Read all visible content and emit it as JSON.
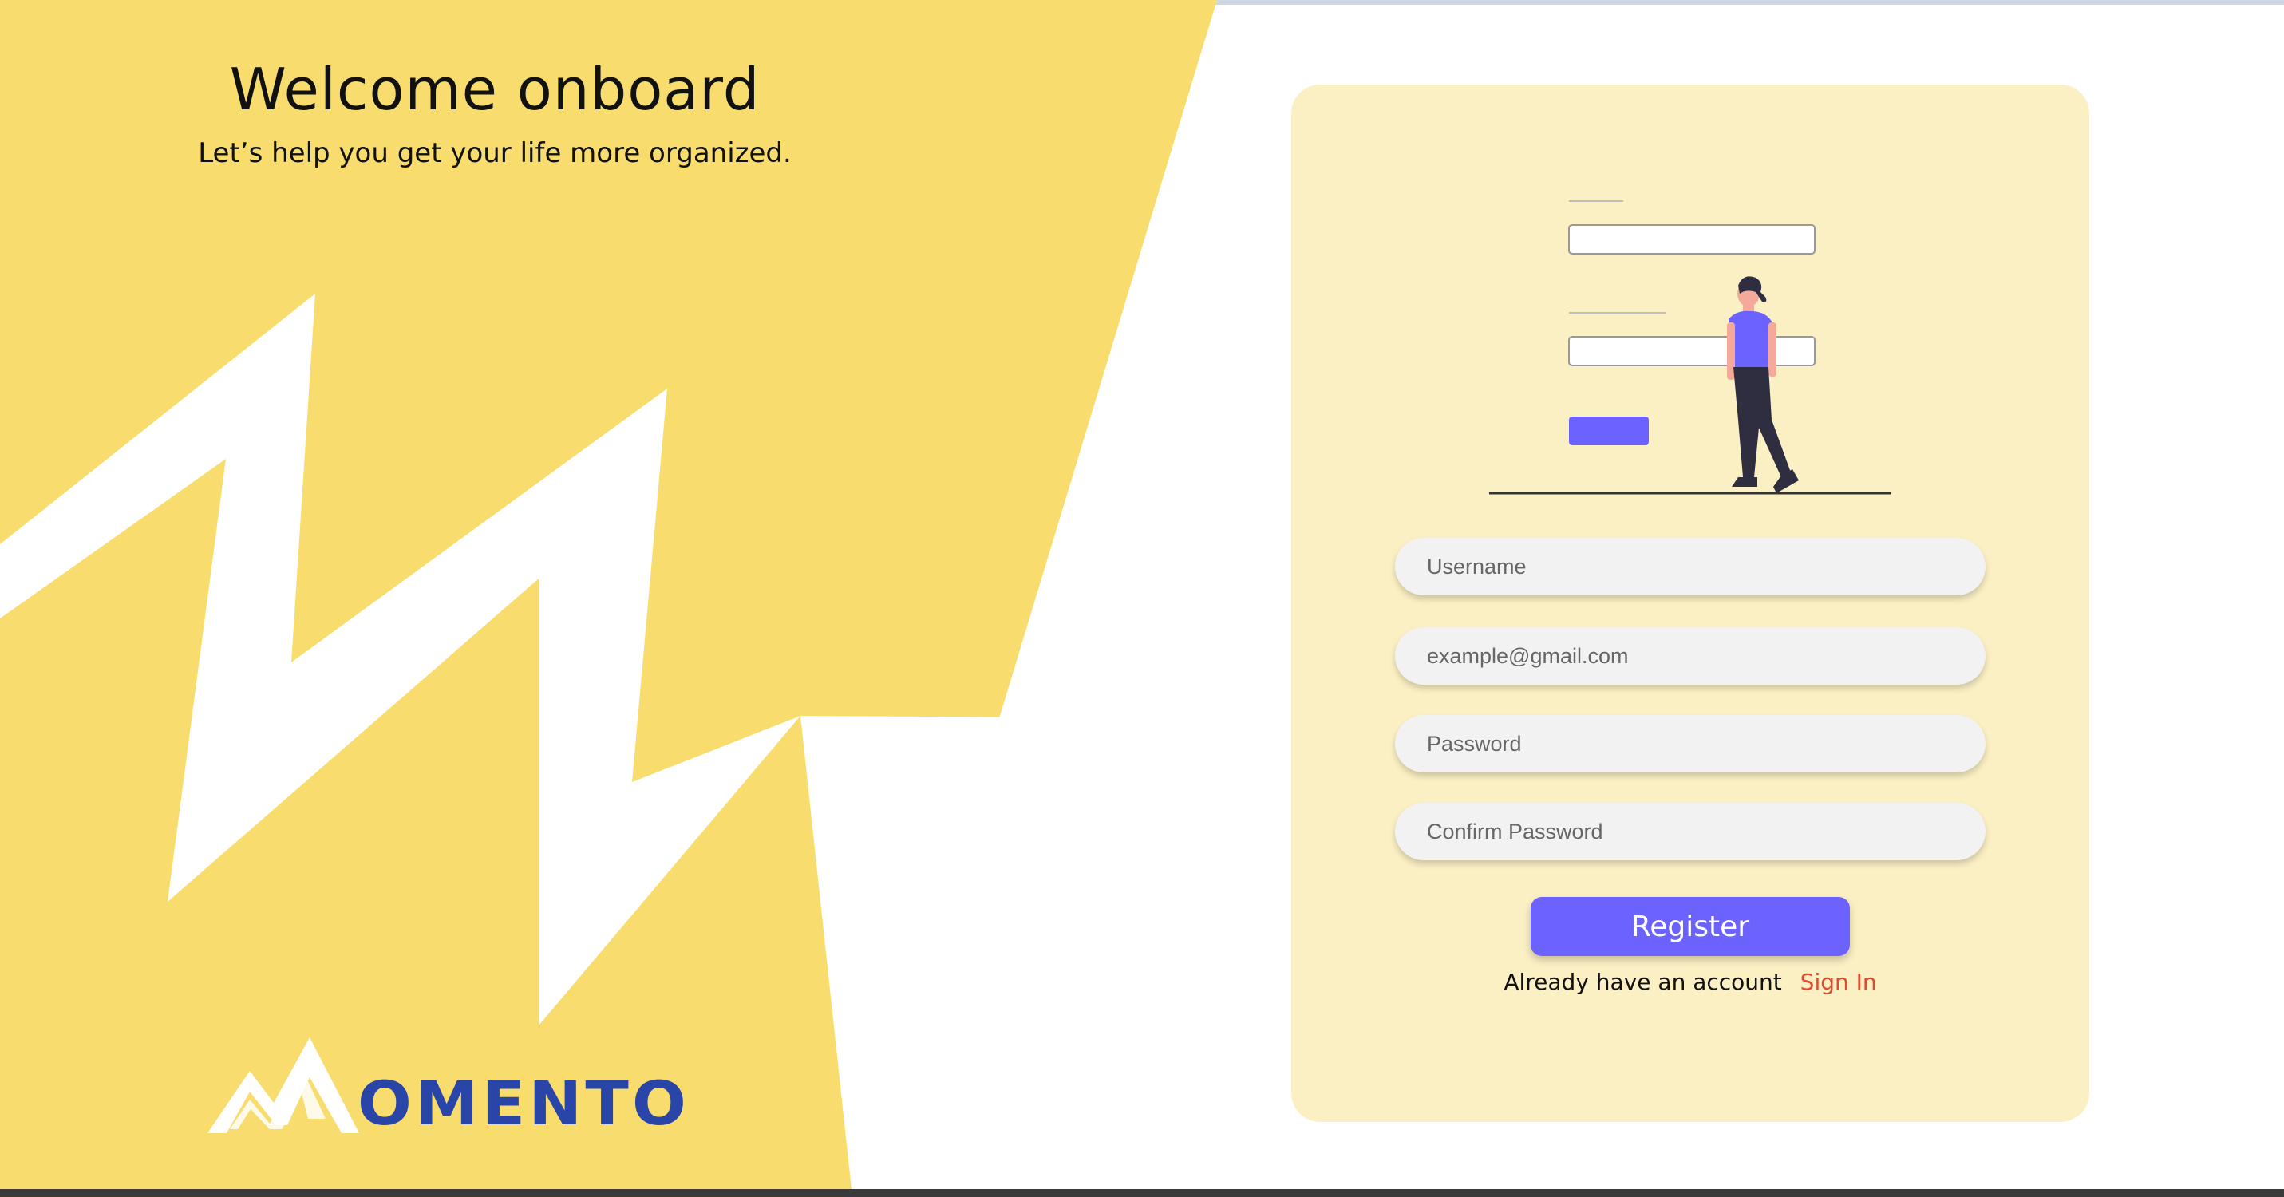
{
  "welcome": {
    "title": "Welcome onboard",
    "subtitle": "Let’s help you get your life more organized."
  },
  "logo": {
    "text": "OMENTO",
    "mark_icon": "mountain-m-logo-icon",
    "color": "#2a45a8"
  },
  "form": {
    "username_placeholder": "Username",
    "email_placeholder": "example@gmail.com",
    "password_placeholder": "Password",
    "confirm_password_placeholder": "Confirm Password",
    "register_label": "Register",
    "signin_prompt": "Already have an account",
    "signin_link": "Sign In"
  },
  "colors": {
    "yellow_panel": "#f8dd6e",
    "card_background": "#fbf0c4",
    "accent_purple": "#6c63ff",
    "signin_red": "#e04a2f"
  }
}
